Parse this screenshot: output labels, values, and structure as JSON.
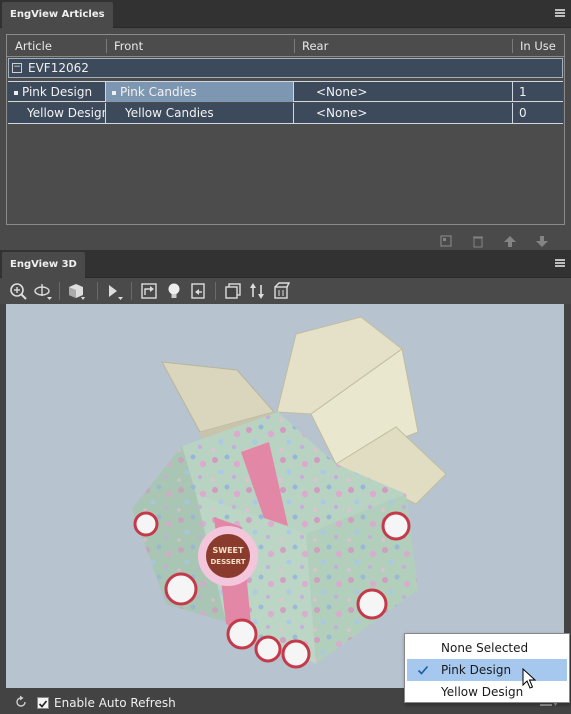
{
  "articles_panel": {
    "title": "EngView Articles",
    "columns": [
      "Article",
      "Front",
      "Rear",
      "In Use"
    ],
    "group": {
      "toggle": "−",
      "label": "EVF12062"
    },
    "rows": [
      {
        "article": "Pink Design",
        "front": "Pink Candies",
        "rear": "<None>",
        "in_use": "1"
      },
      {
        "article": "Yellow Design",
        "front": "Yellow Candies",
        "rear": "<None>",
        "in_use": "0"
      }
    ]
  },
  "view_panel": {
    "title": "EngView 3D",
    "auto_refresh_label": "Enable Auto Refresh",
    "auto_refresh_checked": true,
    "badge_text": [
      "SWEET",
      "DESSERT"
    ]
  },
  "design_menu": {
    "items": [
      {
        "label": "None Selected",
        "checked": false
      },
      {
        "label": "Pink Design",
        "checked": true
      },
      {
        "label": "Yellow Design",
        "checked": false
      }
    ]
  },
  "colors": {
    "panel_bg": "#434343",
    "row_bg": "#3c4a5c",
    "selection": "#7d97b3",
    "viewport_bg": "#b7c3cf",
    "box_green": "#b9d3c2",
    "ribbon_pink": "#e287a6",
    "lid_cream": "#e4e1c8"
  }
}
